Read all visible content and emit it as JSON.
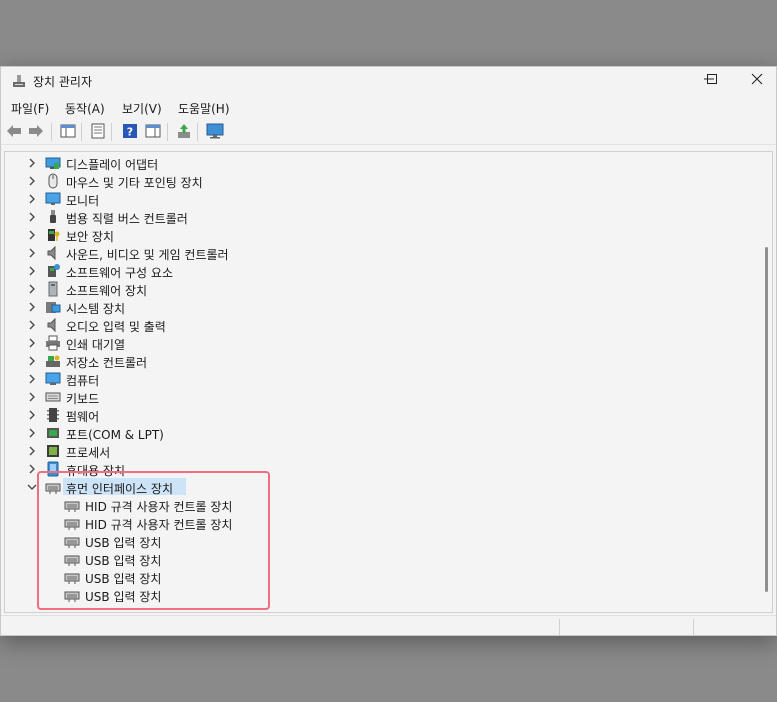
{
  "window": {
    "title": "장치 관리자",
    "controls": {
      "minimize": "—",
      "maximize": "☐",
      "close": "✕"
    }
  },
  "menu": [
    "파일(F)",
    "동작(A)",
    "보기(V)",
    "도움말(H)"
  ],
  "tree": {
    "collapsed_categories": [
      {
        "label": "디스플레이 어댑터",
        "icon": "display-adapter-icon"
      },
      {
        "label": "마우스 및 기타 포인팅 장치",
        "icon": "mouse-icon"
      },
      {
        "label": "모니터",
        "icon": "monitor-icon"
      },
      {
        "label": "범용 직렬 버스 컨트롤러",
        "icon": "usb-icon"
      },
      {
        "label": "보안 장치",
        "icon": "security-device-icon"
      },
      {
        "label": "사운드, 비디오 및 게임 컨트롤러",
        "icon": "speaker-icon"
      },
      {
        "label": "소프트웨어 구성 요소",
        "icon": "software-component-icon"
      },
      {
        "label": "소프트웨어 장치",
        "icon": "software-device-icon"
      },
      {
        "label": "시스템 장치",
        "icon": "system-device-icon"
      },
      {
        "label": "오디오 입력 및 출력",
        "icon": "audio-icon"
      },
      {
        "label": "인쇄 대기열",
        "icon": "printer-icon"
      },
      {
        "label": "저장소 컨트롤러",
        "icon": "storage-controller-icon"
      },
      {
        "label": "컴퓨터",
        "icon": "computer-icon"
      },
      {
        "label": "키보드",
        "icon": "keyboard-icon"
      },
      {
        "label": "펌웨어",
        "icon": "firmware-icon"
      },
      {
        "label": "포트(COM & LPT)",
        "icon": "port-icon"
      },
      {
        "label": "프로세서",
        "icon": "processor-icon"
      },
      {
        "label": "휴대용 장치",
        "icon": "portable-device-icon"
      }
    ],
    "expanded_category": {
      "label": "휴먼 인터페이스 장치",
      "icon": "hid-icon",
      "children": [
        "HID 규격 사용자 컨트롤 장치",
        "HID 규격 사용자 컨트롤 장치",
        "USB 입력 장치",
        "USB 입력 장치",
        "USB 입력 장치",
        "USB 입력 장치"
      ]
    }
  },
  "colors": {
    "selection": "#cde3f7",
    "highlight_border": "#f26d7d",
    "accent": "#0b6fc4"
  }
}
